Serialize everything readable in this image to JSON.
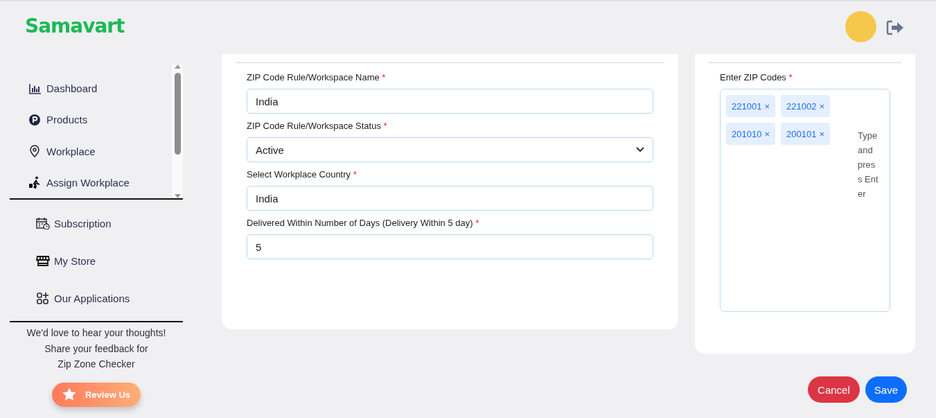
{
  "header": {
    "logo": "Samavart"
  },
  "sidebar": {
    "items": [
      {
        "label": "Dashboard"
      },
      {
        "label": "Products"
      },
      {
        "label": "Workplace"
      },
      {
        "label": "Assign Workplace"
      }
    ],
    "extra_items": [
      {
        "label": "Subscription"
      },
      {
        "label": "My Store"
      },
      {
        "label": "Our Applications"
      }
    ],
    "feedback": [
      "We'd love to hear your thoughts!",
      "Share your feedback for",
      "Zip Zone Checker"
    ],
    "review_button": "Review Us"
  },
  "form": {
    "fields": [
      {
        "kind": "text",
        "label": "ZIP Code Rule/Workspace Name",
        "required": "*",
        "value": "India"
      },
      {
        "kind": "select",
        "label": "ZIP Code Rule/Workspace Status",
        "required": "*",
        "value": "Active"
      },
      {
        "kind": "text",
        "label": "Select Workplace Country",
        "required": "*",
        "value": "India"
      },
      {
        "kind": "text",
        "label": "Delivered Within Number of Days (Delivery Within 5 day)",
        "required": "*",
        "value": "5"
      }
    ]
  },
  "zip_codes": {
    "label": "Enter ZIP Codes",
    "required": "*",
    "chips": [
      {
        "code": "221001",
        "remove": "×"
      },
      {
        "code": "221002",
        "remove": "×"
      },
      {
        "code": "201010",
        "remove": "×"
      },
      {
        "code": "200101",
        "remove": "×"
      }
    ],
    "placeholder": "Type and press Enter"
  },
  "buttons": [
    {
      "kind": "cancel",
      "label": "Cancel"
    },
    {
      "kind": "save",
      "label": "Save"
    }
  ]
}
